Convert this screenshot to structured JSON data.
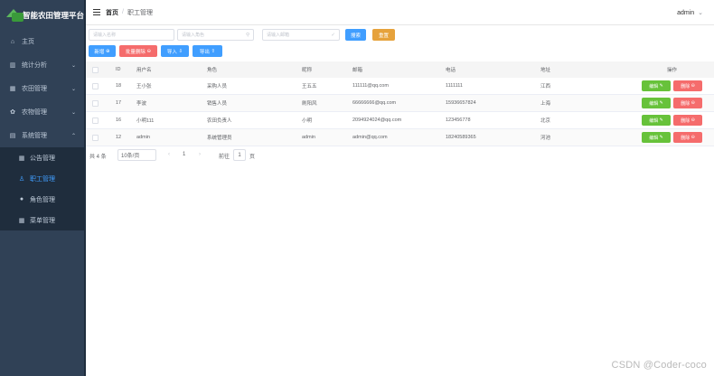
{
  "app": {
    "title": "智能农田管理平台"
  },
  "sidebar": {
    "items": [
      {
        "label": "主页",
        "icon": "home-icon"
      },
      {
        "label": "统计分析",
        "icon": "chart-icon"
      },
      {
        "label": "农田管理",
        "icon": "grid-icon"
      },
      {
        "label": "农物管理",
        "icon": "plant-icon"
      },
      {
        "label": "系统管理",
        "icon": "settings-icon"
      }
    ],
    "sub_items": [
      {
        "label": "公告管理",
        "icon": "notice-icon"
      },
      {
        "label": "职工管理",
        "icon": "user-icon"
      },
      {
        "label": "角色管理",
        "icon": "role-icon"
      },
      {
        "label": "菜单管理",
        "icon": "menu-icon"
      }
    ]
  },
  "header": {
    "breadcrumb_home": "首页",
    "breadcrumb_sep": "/",
    "breadcrumb_current": "职工管理",
    "user": "admin",
    "user_chevron": "⌄"
  },
  "search": {
    "username_placeholder": "请输入名称",
    "role_placeholder": "请输入角色",
    "email_placeholder": "请输入邮箱",
    "search_label": "搜索",
    "reset_label": "重置"
  },
  "toolbar": {
    "add_label": "新增",
    "batch_delete_label": "批量删除",
    "import_label": "导入",
    "export_label": "导出"
  },
  "table": {
    "columns": [
      "ID",
      "用户名",
      "角色",
      "昵称",
      "邮箱",
      "电话",
      "地址",
      "操作"
    ],
    "rows": [
      {
        "id": "18",
        "username": "王小张",
        "role": "采购人员",
        "nickname": "王五五",
        "email": "111111@qq.com",
        "phone": "1111111",
        "address": "江西"
      },
      {
        "id": "17",
        "username": "李波",
        "role": "销售人员",
        "nickname": "刷阳风",
        "email": "66666666@qq.com",
        "phone": "15936657824",
        "address": "上海"
      },
      {
        "id": "16",
        "username": "小明111",
        "role": "农田负责人",
        "nickname": "小明",
        "email": "2094924024@qq.com",
        "phone": "123456778",
        "address": "北京"
      },
      {
        "id": "12",
        "username": "admin",
        "role": "系统管理员",
        "nickname": "admin",
        "email": "admin@qq.com",
        "phone": "18240589365",
        "address": "河池"
      }
    ],
    "edit_label": "编辑",
    "delete_label": "删除"
  },
  "pagination": {
    "total": "共 4 条",
    "page_size": "10条/页",
    "prev": "‹",
    "current_page": "1",
    "next": "›",
    "goto_prefix": "前往",
    "goto_value": "1",
    "goto_suffix": "页"
  },
  "watermark": "CSDN @Coder-coco",
  "colors": {
    "sidebar_bg": "#304156",
    "primary": "#409eff",
    "success": "#67c23a",
    "warning": "#e6a23c",
    "danger": "#f56c6c"
  }
}
